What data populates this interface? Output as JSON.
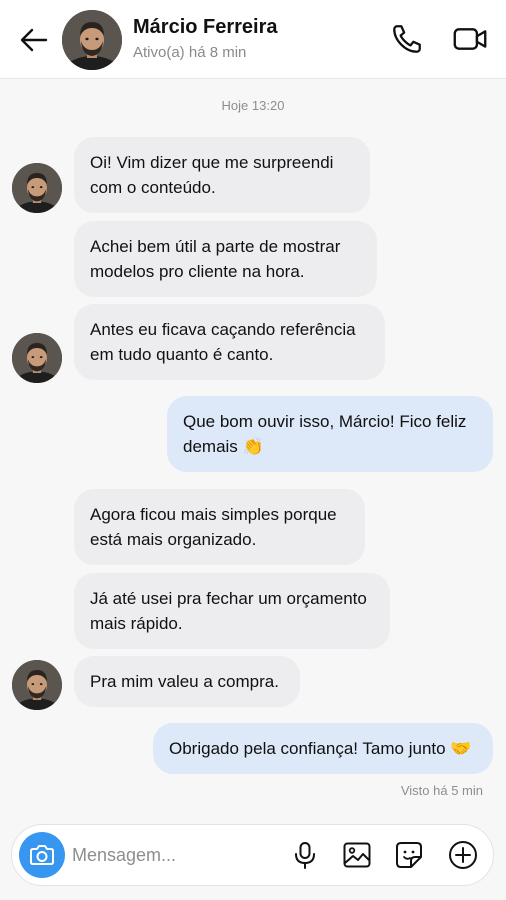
{
  "header": {
    "contact_name": "Márcio Ferreira",
    "status": "Ativo(a) há 8 min",
    "icons": [
      "back-arrow-icon",
      "phone-icon",
      "video-camera-icon"
    ]
  },
  "timestamp": "Hoje 13:20",
  "messages": [
    {
      "from": "them",
      "text_lines": [
        "Oi! Vim dizer que me surpreendi",
        "com o conteúdo."
      ]
    },
    {
      "from": "them",
      "text_lines": [
        "Achei bem útil a parte de mostrar",
        "modelos pro cliente na hora."
      ]
    },
    {
      "from": "them",
      "text_lines": [
        "Antes eu ficava caçando referência",
        "em tudo quanto é canto."
      ]
    },
    {
      "from": "me",
      "text_lines": [
        "Que bom ouvir isso, Márcio! Fico feliz",
        "demais 👏"
      ]
    },
    {
      "from": "them",
      "text_lines": [
        "Agora ficou mais simples porque",
        "está mais organizado."
      ]
    },
    {
      "from": "them",
      "text_lines": [
        "Já até usei pra fechar um orçamento",
        "mais rápido."
      ]
    },
    {
      "from": "them",
      "text_lines": [
        "Pra mim valeu a compra."
      ]
    },
    {
      "from": "me",
      "text_lines": [
        "Obrigado pela confiança! Tamo junto 🤝"
      ]
    }
  ],
  "seen_status": "Visto há 5 min",
  "composer": {
    "placeholder": "Mensagem...",
    "icons": [
      "camera-icon",
      "microphone-icon",
      "image-icon",
      "sticker-icon",
      "plus-icon"
    ]
  },
  "colors": {
    "incoming_bubble": "#ededef",
    "outgoing_bubble": "#dde8f8",
    "camera_button": "#3797f0",
    "background": "#f7f7f8"
  }
}
